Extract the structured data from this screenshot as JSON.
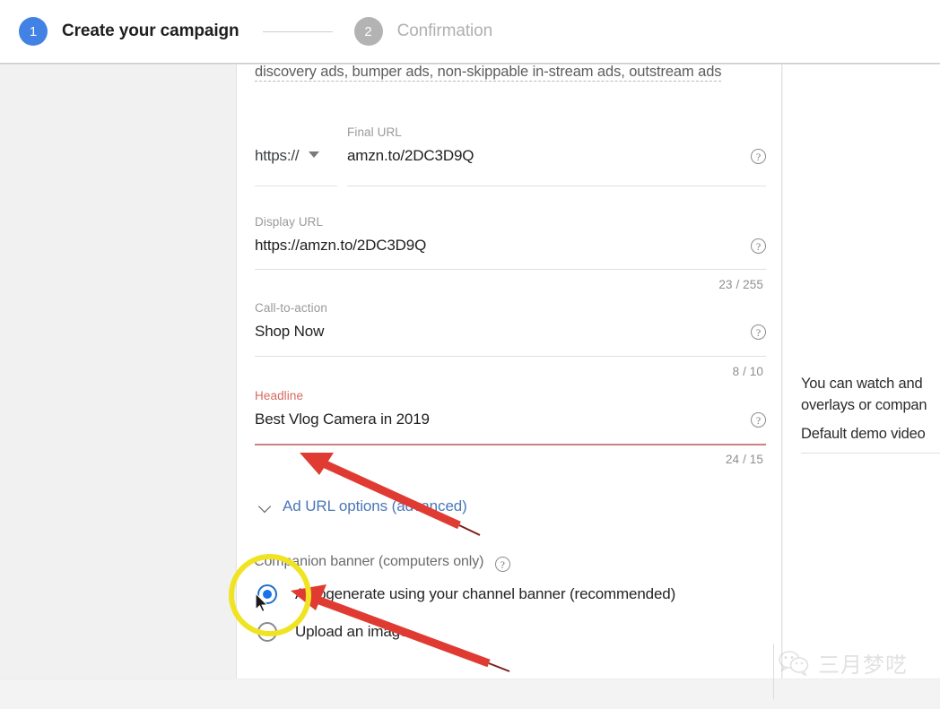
{
  "header": {
    "steps": [
      {
        "number": "1",
        "label": "Create your campaign",
        "state": "active"
      },
      {
        "number": "2",
        "label": "Confirmation",
        "state": "inactive"
      }
    ]
  },
  "form": {
    "ad_formats_line": "discovery ads, bumper ads, non-skippable in-stream ads, outstream ads",
    "final_url": {
      "label": "Final URL",
      "protocol": "https://",
      "value": "amzn.to/2DC3D9Q",
      "help": "?"
    },
    "display_url": {
      "label": "Display URL",
      "value": "https://amzn.to/2DC3D9Q",
      "counter": "23 / 255",
      "help": "?"
    },
    "call_to_action": {
      "label": "Call-to-action",
      "value": "Shop Now",
      "counter": "8 / 10",
      "help": "?"
    },
    "headline": {
      "label": "Headline",
      "value": "Best Vlog Camera in 2019",
      "counter": "24 / 15",
      "help": "?",
      "state": "error"
    },
    "ad_url_options": {
      "label": "Ad URL options (advanced)",
      "expanded": true
    },
    "companion_banner": {
      "label": "Companion banner (computers only)",
      "help": "?",
      "options": [
        {
          "label": "Autogenerate using your channel banner (recommended)",
          "selected": true
        },
        {
          "label": "Upload an image",
          "selected": false
        }
      ]
    }
  },
  "side_panel": {
    "lines": [
      "You can watch and",
      "overlays or compan",
      "Default demo video"
    ]
  },
  "watermark": {
    "text": "三月梦呓"
  },
  "colors": {
    "accent_blue": "#4182e4",
    "radio_blue": "#1a73e8",
    "link_blue": "#4a76b8",
    "error_red": "#d4695f",
    "highlight_yellow": "#f0e422",
    "arrow_red": "#e03b32",
    "inactive_gray": "#b3b3b3"
  }
}
